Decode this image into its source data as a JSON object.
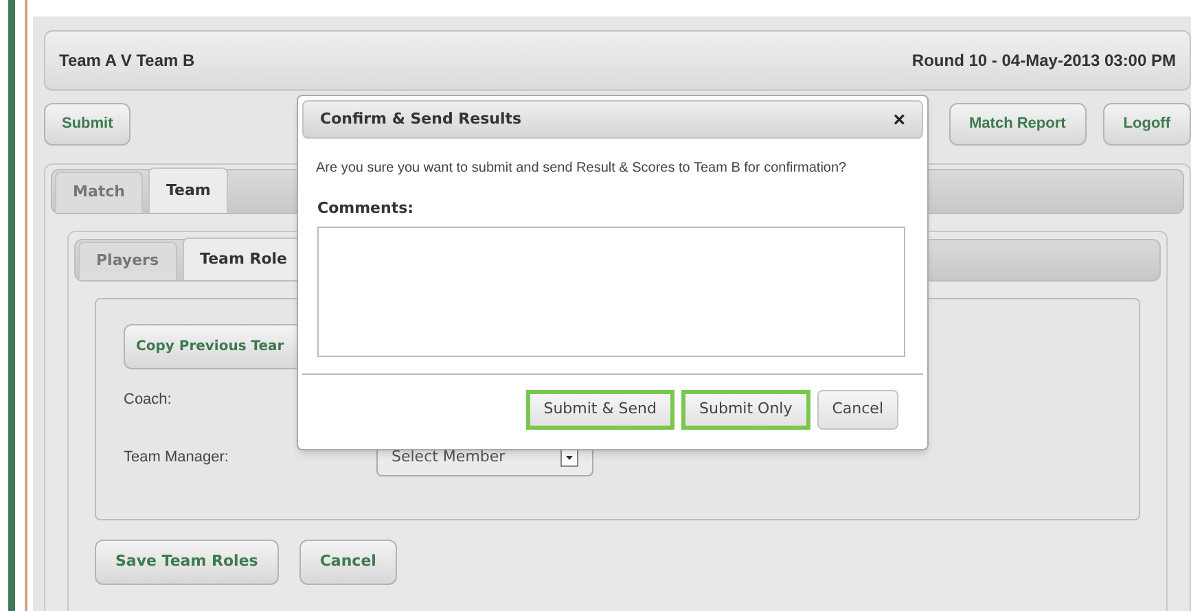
{
  "header": {
    "title": "Team A V Team B",
    "round": "Round 10 - 04-May-2013 03:00 PM"
  },
  "toolbar": {
    "left": [
      "Submit"
    ],
    "right": [
      "Match Report",
      "Logoff"
    ]
  },
  "tabs": [
    {
      "label": "Match",
      "selected": false
    },
    {
      "label": "Team",
      "selected": true
    }
  ],
  "subtabs": [
    {
      "label": "Players",
      "selected": false
    },
    {
      "label": "Team Role",
      "selected": true
    }
  ],
  "copy_button": "Copy Previous Tear",
  "roles": [
    {
      "label": "Coach:"
    },
    {
      "label": "Team Manager:",
      "select": "Select Member"
    }
  ],
  "actions": [
    "Save Team Roles",
    "Cancel"
  ],
  "dialog": {
    "title": "Confirm & Send Results",
    "close": "×",
    "message": "Are you sure you want to submit and send Result & Scores to Team B for confirmation?",
    "comments_label": "Comments:",
    "buttons": [
      {
        "label": "Submit & Send",
        "highlighted": true
      },
      {
        "label": "Submit Only",
        "highlighted": true
      },
      {
        "label": "Cancel",
        "highlighted": false
      }
    ]
  }
}
